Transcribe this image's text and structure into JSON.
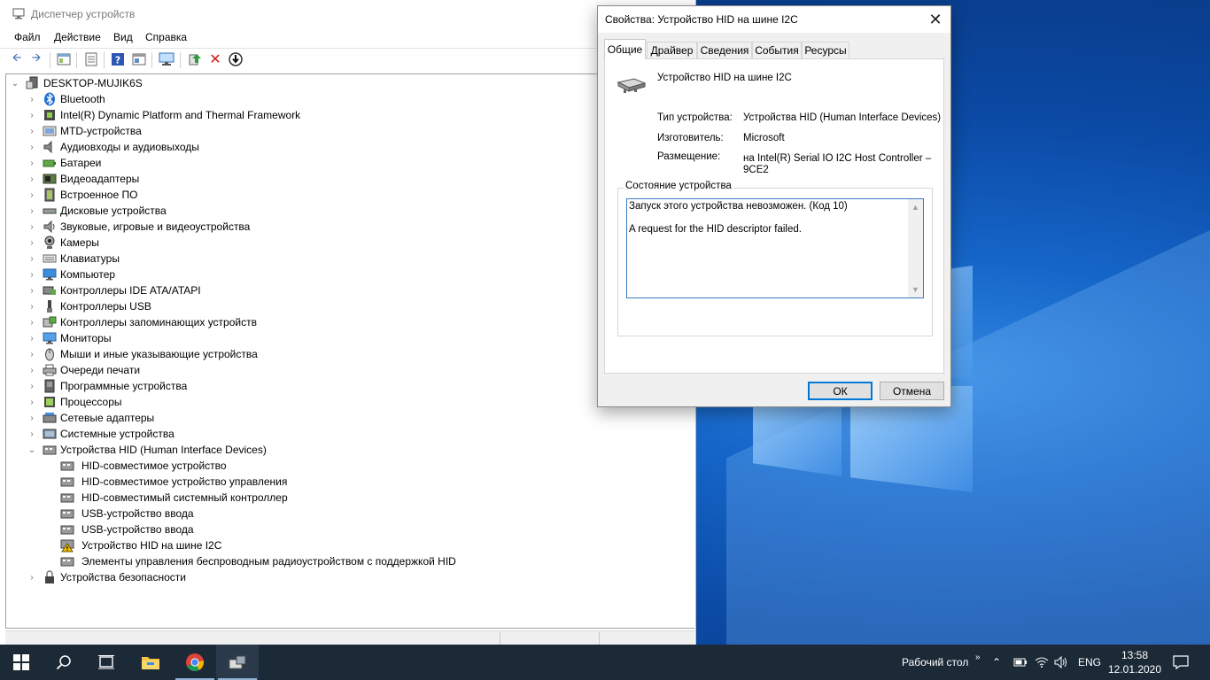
{
  "device_manager": {
    "title": "Диспетчер устройств",
    "menu": [
      "Файл",
      "Действие",
      "Вид",
      "Справка"
    ],
    "root": "DESKTOP-MUJIK6S",
    "categories": [
      "Bluetooth",
      "Intel(R) Dynamic Platform and Thermal Framework",
      "MTD-устройства",
      "Аудиовходы и аудиовыходы",
      "Батареи",
      "Видеоадаптеры",
      "Встроенное ПО",
      "Дисковые устройства",
      "Звуковые, игровые и видеоустройства",
      "Камеры",
      "Клавиатуры",
      "Компьютер",
      "Контроллеры IDE ATA/ATAPI",
      "Контроллеры USB",
      "Контроллеры запоминающих устройств",
      "Мониторы",
      "Мыши и иные указывающие устройства",
      "Очереди печати",
      "Программные устройства",
      "Процессоры",
      "Сетевые адаптеры",
      "Системные устройства",
      "Устройства HID (Human Interface Devices)"
    ],
    "hid_children": [
      "HID-совместимое устройство",
      "HID-совместимое устройство управления",
      "HID-совместимый системный контроллер",
      "USB-устройство ввода",
      "USB-устройство ввода",
      "Устройство HID на шине I2C",
      "Элементы управления беспроводным радиоустройством с поддержкой HID"
    ],
    "last_category": "Устройства безопасности"
  },
  "dialog": {
    "title": "Свойства: Устройство HID на шине I2C",
    "tabs": [
      "Общие",
      "Драйвер",
      "Сведения",
      "События",
      "Ресурсы"
    ],
    "device_name": "Устройство HID на шине I2C",
    "type_label": "Тип устройства:",
    "type_value": "Устройства HID (Human Interface Devices)",
    "manufacturer_label": "Изготовитель:",
    "manufacturer_value": "Microsoft",
    "location_label": "Размещение:",
    "location_value_line1": "на Intel(R) Serial IO I2C Host Controller –",
    "location_value_line2": "9CE2",
    "status_group": "Состояние устройства",
    "status_line1": "Запуск этого устройства невозможен. (Код 10)",
    "status_line2": "A request for the HID descriptor failed.",
    "ok": "ОК",
    "cancel": "Отмена"
  },
  "taskbar": {
    "desktop_label": "Рабочий стол",
    "lang": "ENG",
    "time": "13:58",
    "date": "12.01.2020"
  }
}
